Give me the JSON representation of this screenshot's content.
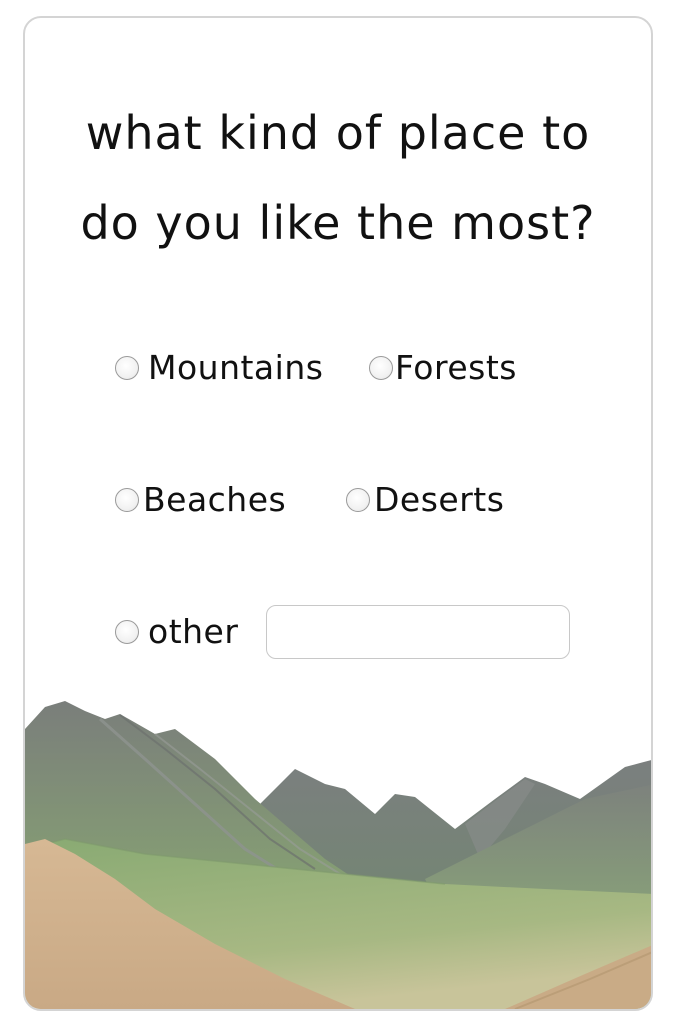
{
  "question": {
    "line1": "what kind of place to",
    "line2": "do you like the most?"
  },
  "options": [
    {
      "label": "Mountains"
    },
    {
      "label": "Forests"
    },
    {
      "label": "Beaches"
    },
    {
      "label": "Deserts"
    },
    {
      "label": "other"
    }
  ],
  "other_input": {
    "value": "",
    "placeholder": ""
  },
  "scenery": {
    "icon": "mountain-landscape-illustration"
  }
}
